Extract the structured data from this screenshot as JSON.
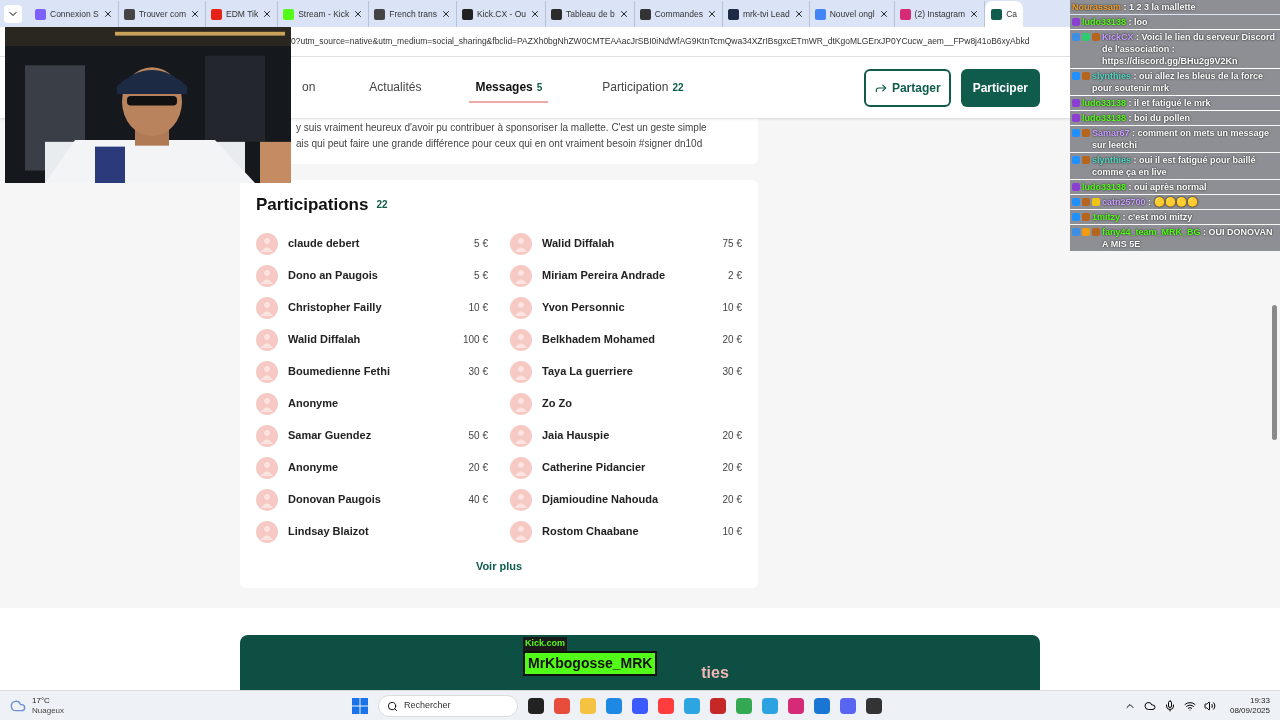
{
  "browser": {
    "tabs": [
      {
        "title": "Connexion S",
        "selected": false,
        "color": "#7b61ff"
      },
      {
        "title": "Trouver com",
        "selected": false,
        "color": "#444444"
      },
      {
        "title": "EDM Tik",
        "selected": false,
        "color": "#e62117"
      },
      {
        "title": "Stream - Kick",
        "selected": false,
        "color": "#53fc18"
      },
      {
        "title": "French trans",
        "selected": false,
        "color": "#444444"
      },
      {
        "title": "Kick.CX - Ou",
        "selected": false,
        "color": "#222222"
      },
      {
        "title": "Tableau de b",
        "selected": false,
        "color": "#2b2b2b"
      },
      {
        "title": "Commandes",
        "selected": false,
        "color": "#333333"
      },
      {
        "title": "mrk-tvi Lead",
        "selected": false,
        "color": "#1f2a44"
      },
      {
        "title": "Nouvel ongl",
        "selected": false,
        "color": "#4285f4"
      },
      {
        "title": "(2) Instagram",
        "selected": false,
        "color": "#d62976"
      },
      {
        "title": "Ca",
        "selected": true,
        "color": "#0f5c4d"
      }
    ],
    "url": "0?utm_source=native&utm_medium=social_sharing&fbclid=PAZXh0bgNhZW0CMTEAAacJrSBI0iNdWfAG9KtnTcmQwa34XZrIBsgxcETmWR_dtKgoMLGErxJP0YCucw_aem__FPw8j41oB6xyAbkd"
  },
  "nav": {
    "items": [
      {
        "label": "on",
        "selected": false
      },
      {
        "label": "Actualités",
        "selected": false
      },
      {
        "label": "Messages",
        "count": "5",
        "selected": true
      },
      {
        "label": "Participation",
        "count": "22",
        "selected": false
      }
    ],
    "share_button": "Partager",
    "participate_button": "Participer"
  },
  "message": {
    "lines": [
      "y suis vraiment heureux d'avoir pu contribuer à sponsoriser la mallette. C'est un geste simple",
      "ais qui peut faire une grande différence pour ceux qui en ont vraiment besoin #signer dn10d"
    ]
  },
  "participations": {
    "title": "Participations",
    "count": "22",
    "columns": [
      [
        {
          "name": "claude debert",
          "amount": "5 €"
        },
        {
          "name": "Dono an Paugois",
          "amount": "5 €"
        },
        {
          "name": "Christopher Failly",
          "amount": "10 €"
        },
        {
          "name": "Walid Diffalah",
          "amount": "100 €"
        },
        {
          "name": "Boumedienne Fethi",
          "amount": "30 €"
        },
        {
          "name": "Anonyme"
        },
        {
          "name": "Samar Guendez",
          "amount": "50 €"
        },
        {
          "name": "Anonyme",
          "amount": "20 €"
        },
        {
          "name": "Donovan Paugois",
          "amount": "40 €"
        },
        {
          "name": "Lindsay Blaizot"
        }
      ],
      [
        {
          "name": "Walid Diffalah",
          "amount": "75 €"
        },
        {
          "name": "Miriam Pereira Andrade",
          "amount": "2 €"
        },
        {
          "name": "Yvon Personnic",
          "amount": "10 €"
        },
        {
          "name": "Belkhadem Mohamed",
          "amount": "20 €"
        },
        {
          "name": "Taya La guerriere",
          "amount": "30 €"
        },
        {
          "name": "Zo Zo"
        },
        {
          "name": "Jaia Hauspie",
          "amount": "20 €"
        },
        {
          "name": "Catherine Pidancier",
          "amount": "20 €"
        },
        {
          "name": "Djamioudine Nahouda",
          "amount": "20 €"
        },
        {
          "name": "Rostom Chaabane",
          "amount": "10 €"
        }
      ]
    ],
    "more_link": "Voir plus"
  },
  "banner": {
    "title": "ties",
    "overlay_site": "Kick.com",
    "overlay_channel": "MrKbogosse_MRK"
  },
  "chat": {
    "messages": [
      {
        "user": "Nourassam",
        "color": "#f0a030",
        "text": ": 1 2 3 la mallette"
      },
      {
        "user": "ludo33138",
        "color": "#53fc18",
        "text": ": loo",
        "badges": [
          {
            "color": "#8a3fd1"
          }
        ]
      },
      {
        "user": "KickCX",
        "color": "#c9a0ff",
        "text": ": Voici le lien du serveur Discord de l'association : https://discord.gg/BHu2g9V2Kn",
        "badges": [
          {
            "color": "#3a8ee6"
          },
          {
            "color": "#2ecc71"
          },
          {
            "color": "#b5651d"
          }
        ]
      },
      {
        "user": "slynthies",
        "color": "#53d6c0",
        "text": ": oui allez les bleus de la force pour soutenir mrk",
        "badges": [
          {
            "color": "#1e90ff"
          },
          {
            "color": "#b5651d"
          }
        ]
      },
      {
        "user": "ludo33138",
        "color": "#53fc18",
        "text": ": il et fatigué le mrk",
        "badges": [
          {
            "color": "#8a3fd1"
          }
        ]
      },
      {
        "user": "ludo33138",
        "color": "#53fc18",
        "text": ": boi du pollen",
        "badges": [
          {
            "color": "#8a3fd1"
          }
        ]
      },
      {
        "user": "Samar67",
        "color": "#c9a0ff",
        "text": ": comment on mets un message sur leetchi",
        "badges": [
          {
            "color": "#1e90ff"
          },
          {
            "color": "#b5651d"
          }
        ]
      },
      {
        "user": "slynthies",
        "color": "#53d6c0",
        "text": ": oui il est fatigué pour baillé comme ça en live",
        "badges": [
          {
            "color": "#1e90ff"
          },
          {
            "color": "#b5651d"
          }
        ]
      },
      {
        "user": "ludo33138",
        "color": "#53fc18",
        "text": ": oui après normal",
        "badges": [
          {
            "color": "#8a3fd1"
          }
        ]
      },
      {
        "user": "catn25700",
        "color": "#c9a0ff",
        "text": ": 🟡🟡🟡🟡",
        "badges": [
          {
            "color": "#1e90ff"
          },
          {
            "color": "#b5651d"
          },
          {
            "color": "#f1c40f"
          }
        ]
      },
      {
        "user": "1mitzy",
        "color": "#53fc18",
        "text": ": c'est moi mitzy",
        "badges": [
          {
            "color": "#1e90ff"
          },
          {
            "color": "#b5651d"
          }
        ]
      },
      {
        "user": "fany44_team_MRK_BG",
        "color": "#53fc18",
        "text": ": OUI DONOVAN A MIS 5E",
        "badges": [
          {
            "color": "#3a8ee6"
          },
          {
            "color": "#f39c12"
          },
          {
            "color": "#b5651d"
          }
        ]
      }
    ]
  },
  "taskbar": {
    "temperature": "17°C",
    "weather": "Nuageux",
    "search_placeholder": "Rechercher",
    "time": "19:33",
    "date": "08/09/2025"
  }
}
